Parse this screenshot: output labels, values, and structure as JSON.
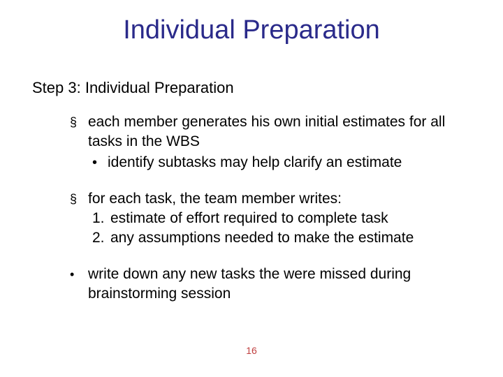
{
  "title": "Individual Preparation",
  "subtitle": "Step 3: Individual Preparation",
  "bullets": {
    "b1": {
      "main": "each member generates his own initial estimates for all tasks in the WBS",
      "sub1": "identify subtasks may help clarify an estimate"
    },
    "b2": {
      "main": "for each task, the team member writes:",
      "n1": "estimate of effort required to complete task",
      "n2": "any assumptions needed to make the estimate"
    },
    "b3": {
      "main": "write down any new tasks the were missed during brainstorming session"
    }
  },
  "numlabels": {
    "one": "1.",
    "two": "2."
  },
  "page_number": "16"
}
